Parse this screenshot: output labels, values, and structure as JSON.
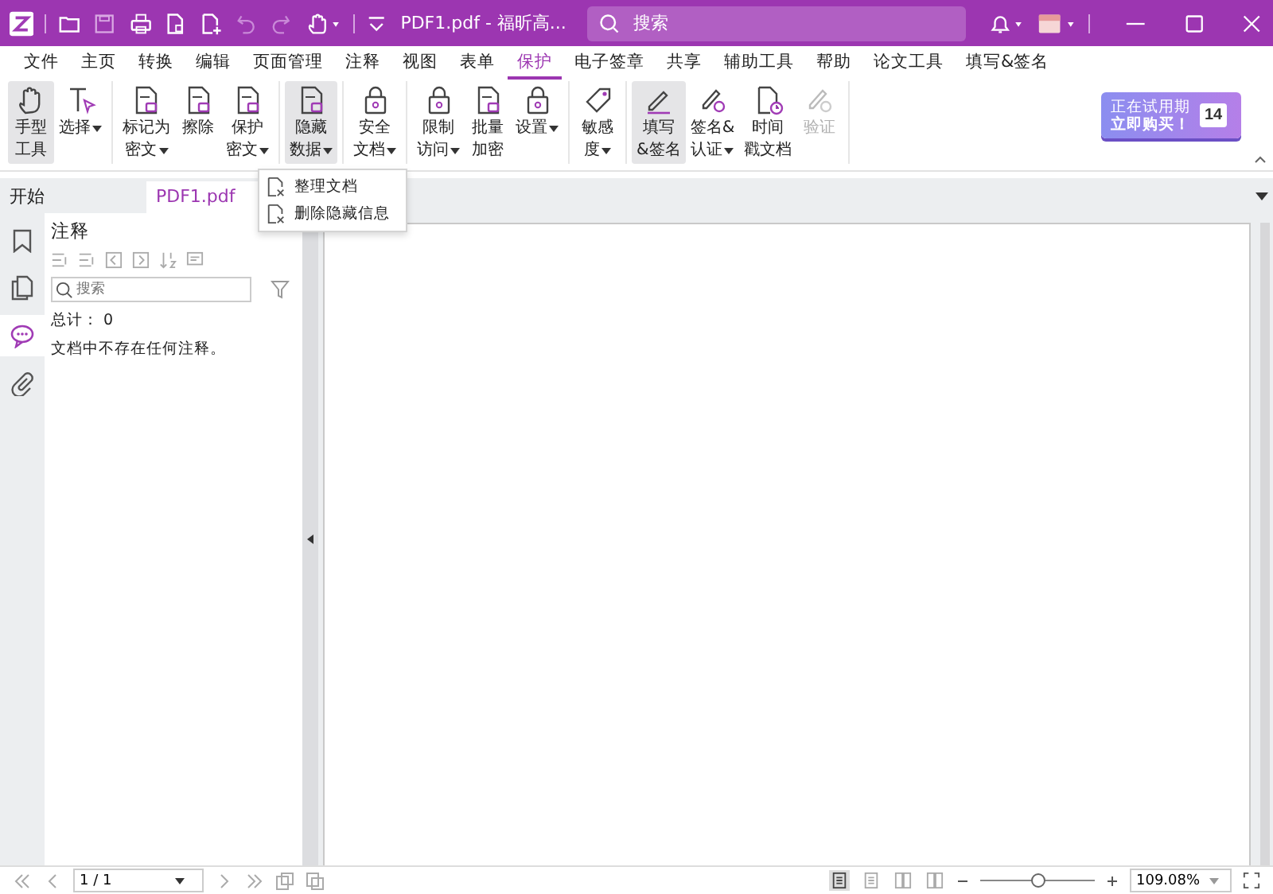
{
  "window": {
    "title": "PDF1.pdf - 福昕高...",
    "search_placeholder": "搜索"
  },
  "menu_tabs": [
    {
      "label": "文件",
      "selected": false
    },
    {
      "label": "主页",
      "selected": false
    },
    {
      "label": "转换",
      "selected": false
    },
    {
      "label": "编辑",
      "selected": false
    },
    {
      "label": "页面管理",
      "selected": false
    },
    {
      "label": "注释",
      "selected": false
    },
    {
      "label": "视图",
      "selected": false
    },
    {
      "label": "表单",
      "selected": false
    },
    {
      "label": "保护",
      "selected": true
    },
    {
      "label": "电子签章",
      "selected": false
    },
    {
      "label": "共享",
      "selected": false
    },
    {
      "label": "辅助工具",
      "selected": false
    },
    {
      "label": "帮助",
      "selected": false
    },
    {
      "label": "论文工具",
      "selected": false
    },
    {
      "label": "填写&签名",
      "selected": false
    }
  ],
  "ribbon_groups": [
    [
      {
        "lines": [
          "手型",
          "工具"
        ],
        "dropdown": false,
        "selected": true,
        "disabled": false
      },
      {
        "lines": [
          "选择"
        ],
        "dropdown": true,
        "selected": false,
        "disabled": false
      }
    ],
    [
      {
        "lines": [
          "标记为",
          "密文"
        ],
        "dropdown": true,
        "selected": false,
        "disabled": false
      },
      {
        "lines": [
          "擦除"
        ],
        "dropdown": false,
        "selected": false,
        "disabled": false
      },
      {
        "lines": [
          "保护",
          "密文"
        ],
        "dropdown": true,
        "selected": false,
        "disabled": false
      }
    ],
    [
      {
        "lines": [
          "隐藏",
          "数据"
        ],
        "dropdown": true,
        "selected": true,
        "disabled": false
      }
    ],
    [
      {
        "lines": [
          "安全",
          "文档"
        ],
        "dropdown": true,
        "selected": false,
        "disabled": false
      }
    ],
    [
      {
        "lines": [
          "限制",
          "访问"
        ],
        "dropdown": true,
        "selected": false,
        "disabled": false
      },
      {
        "lines": [
          "批量",
          "加密"
        ],
        "dropdown": false,
        "selected": false,
        "disabled": false
      },
      {
        "lines": [
          "设置"
        ],
        "dropdown": true,
        "selected": false,
        "disabled": false
      }
    ],
    [
      {
        "lines": [
          "敏感",
          "度"
        ],
        "dropdown": true,
        "selected": false,
        "disabled": false
      }
    ],
    [
      {
        "lines": [
          "填写",
          "&签名"
        ],
        "dropdown": false,
        "selected": true,
        "disabled": false
      },
      {
        "lines": [
          "签名&",
          "认证"
        ],
        "dropdown": true,
        "selected": false,
        "disabled": false
      },
      {
        "lines": [
          "时间",
          "戳文档"
        ],
        "dropdown": false,
        "selected": false,
        "disabled": false
      },
      {
        "lines": [
          "验证"
        ],
        "dropdown": false,
        "selected": false,
        "disabled": true
      }
    ]
  ],
  "trial": {
    "line_1": "正在试用期",
    "line_2": "立即购买！",
    "days": "14"
  },
  "dropdown_menu": [
    "整理文档",
    "删除隐藏信息"
  ],
  "doc_tabs": [
    {
      "label": "开始",
      "selected": false
    },
    {
      "label": "PDF1.pdf",
      "selected": true
    }
  ],
  "sidebar_tabs": [
    {
      "selected": false
    },
    {
      "selected": false
    },
    {
      "selected": true
    },
    {
      "selected": false
    }
  ],
  "comments_panel": {
    "title": "注释",
    "search_placeholder": "搜索",
    "total": "总计： 0",
    "message": "文档中不存在任何注释。"
  },
  "status_bar": {
    "page": "1 / 1",
    "view_modes": [
      {
        "selected": true
      },
      {
        "selected": false
      },
      {
        "selected": false
      },
      {
        "selected": false
      }
    ],
    "zoom": {
      "level": 0.5
    },
    "zoom_value": "109.08%"
  }
}
